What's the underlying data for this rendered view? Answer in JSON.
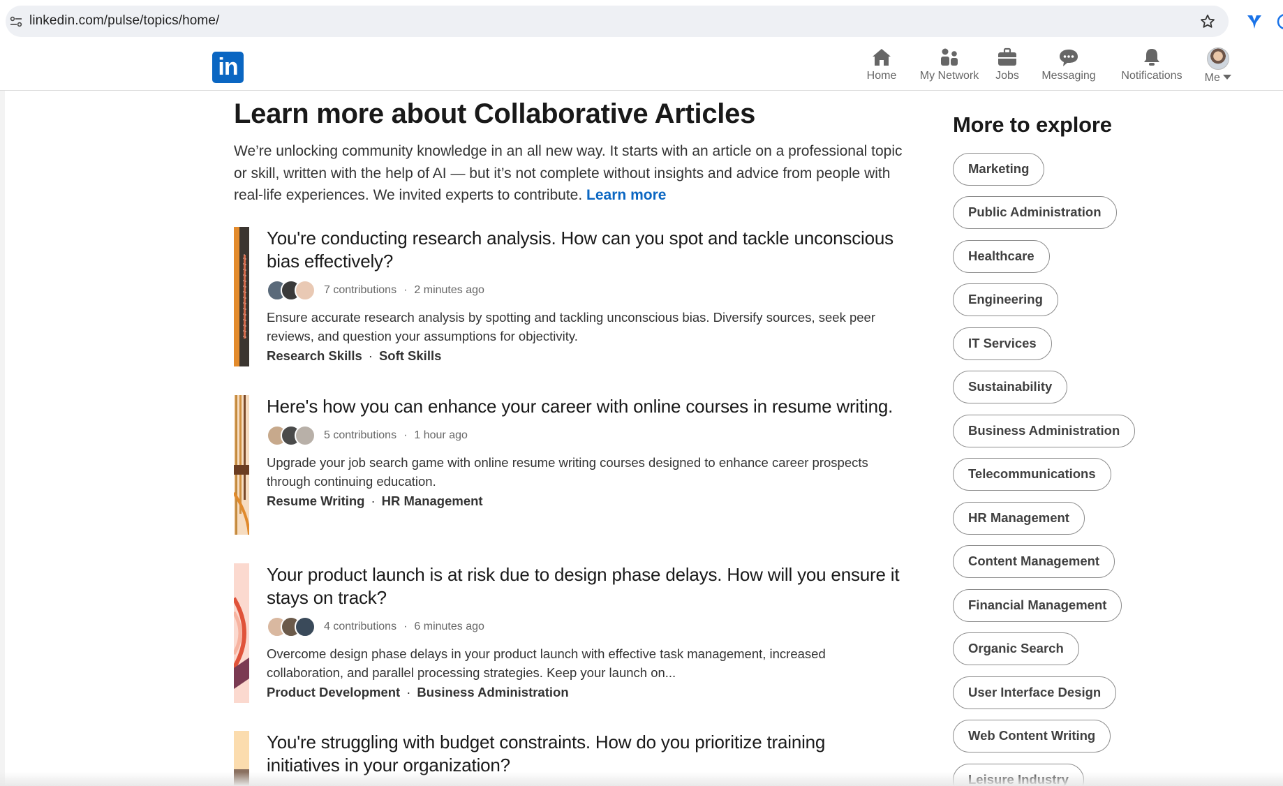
{
  "browser": {
    "url": "linkedin.com/pulse/topics/home/",
    "icons": [
      "site-info-icon",
      "star-icon",
      "extension-icon"
    ]
  },
  "nav": {
    "logo_text": "in",
    "items": [
      {
        "label": "Home",
        "icon": "home-icon"
      },
      {
        "label": "My Network",
        "icon": "network-icon"
      },
      {
        "label": "Jobs",
        "icon": "briefcase-icon"
      },
      {
        "label": "Messaging",
        "icon": "chat-bubble-icon"
      },
      {
        "label": "Notifications",
        "icon": "bell-icon"
      },
      {
        "label": "Me",
        "icon": "avatar"
      }
    ]
  },
  "header": {
    "title": "Learn more about Collaborative Articles",
    "intro": "We’re unlocking community knowledge in an all new way. It starts with an article on a professional topic or skill, written with the help of AI — but it’s not complete without insights and advice from people with real-life experiences. We invited experts to contribute.",
    "learn_more": "Learn more"
  },
  "articles": [
    {
      "title": "You're conducting research analysis. How can you spot and tackle unconscious bias effectively?",
      "contributions": "7 contributions",
      "time": "2 minutes ago",
      "summary": "Ensure accurate research analysis by spotting and tackling unconscious bias. Diversify sources, seek peer reviews, and question your assumptions for objectivity.",
      "tags": [
        "Research Skills",
        "Soft Skills"
      ]
    },
    {
      "title": "Here's how you can enhance your career with online courses in resume writing.",
      "contributions": "5 contributions",
      "time": "1 hour ago",
      "summary": "Upgrade your job search game with online resume writing courses designed to enhance career prospects through continuing education.",
      "tags": [
        "Resume Writing",
        "HR Management"
      ]
    },
    {
      "title": "Your product launch is at risk due to design phase delays. How will you ensure it stays on track?",
      "contributions": "4 contributions",
      "time": "6 minutes ago",
      "summary": "Overcome design phase delays in your product launch with effective task management, increased collaboration, and parallel processing strategies. Keep your launch on...",
      "tags": [
        "Product Development",
        "Business Administration"
      ]
    },
    {
      "title": "You're struggling with budget constraints. How do you prioritize training initiatives in your organization?",
      "contributions": "",
      "time": "",
      "summary": "",
      "tags": []
    }
  ],
  "sidebar": {
    "title": "More to explore",
    "topics": [
      "Marketing",
      "Public Administration",
      "Healthcare",
      "Engineering",
      "IT Services",
      "Sustainability",
      "Business Administration",
      "Telecommunications",
      "HR Management",
      "Content Management",
      "Financial Management",
      "Organic Search",
      "User Interface Design",
      "Web Content Writing",
      "Leisure Industry"
    ]
  },
  "colors": {
    "brand": "#0a66c2",
    "link": "#0a66c2",
    "text": "#191919"
  }
}
